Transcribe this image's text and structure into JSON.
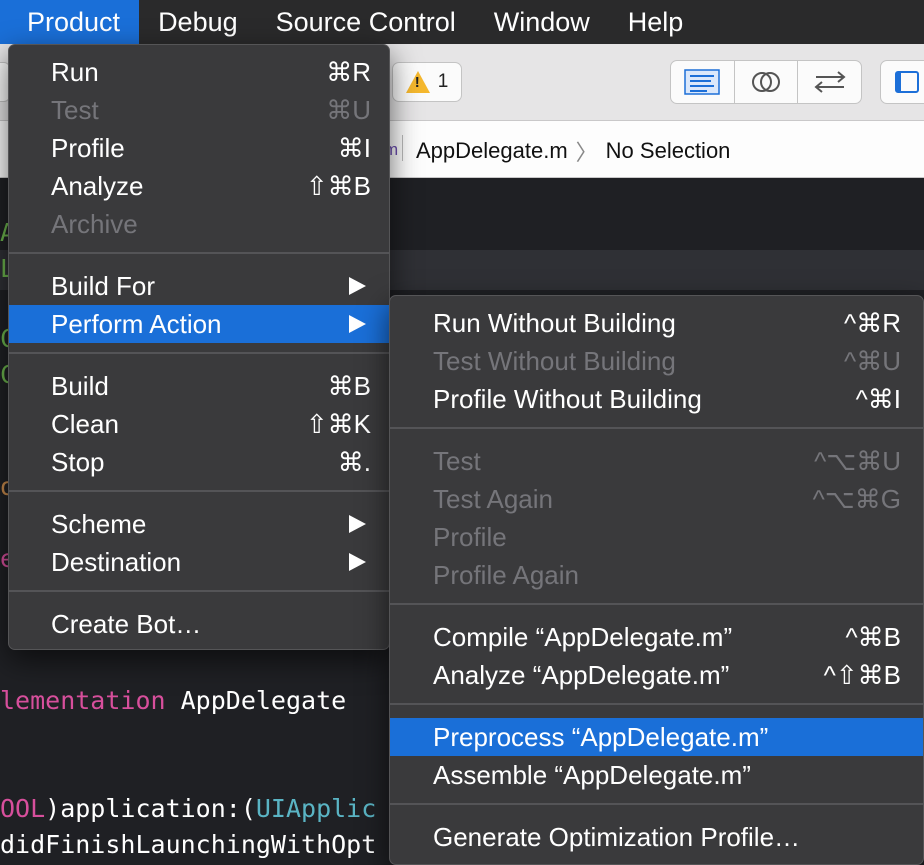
{
  "menubar": {
    "items": [
      "Product",
      "Debug",
      "Source Control",
      "Window",
      "Help"
    ]
  },
  "toolbar": {
    "warning_count": "1"
  },
  "jumpbar": {
    "file": "AppDelegate.m",
    "selection": "No Selection",
    "file_icon_glyph": "m"
  },
  "editor": {
    "lines": {
      "implementation_kw": "lementation",
      "implementation_name": " AppDelegate",
      "app_prefix": "OOL",
      "app_method": ")application:(",
      "app_type": "UIApplic",
      "did_finish": "didFinishLaunchingWithOpt",
      "frag_a": "A",
      "frag_l": "L",
      "frag_c": "C",
      "frag_c2": "C",
      "frag_o": "o",
      "frag_e": "e"
    }
  },
  "product_menu": {
    "items": [
      {
        "label": "Run",
        "shortcut": "⌘R",
        "enabled": true
      },
      {
        "label": "Test",
        "shortcut": "⌘U",
        "enabled": false
      },
      {
        "label": "Profile",
        "shortcut": "⌘I",
        "enabled": true
      },
      {
        "label": "Analyze",
        "shortcut": "⇧⌘B",
        "enabled": true
      },
      {
        "label": "Archive",
        "shortcut": "",
        "enabled": false
      },
      {
        "label": "Build For",
        "submenu": true,
        "enabled": true
      },
      {
        "label": "Perform Action",
        "submenu": true,
        "enabled": true,
        "selected": true
      },
      {
        "label": "Build",
        "shortcut": "⌘B",
        "enabled": true
      },
      {
        "label": "Clean",
        "shortcut": "⇧⌘K",
        "enabled": true
      },
      {
        "label": "Stop",
        "shortcut": "⌘.",
        "enabled": true
      },
      {
        "label": "Scheme",
        "submenu": true,
        "enabled": true
      },
      {
        "label": "Destination",
        "submenu": true,
        "enabled": true
      },
      {
        "label": "Create Bot…",
        "shortcut": "",
        "enabled": true
      }
    ]
  },
  "perform_action_menu": {
    "items": [
      {
        "label": "Run Without Building",
        "shortcut": "^⌘R",
        "enabled": true
      },
      {
        "label": "Test Without Building",
        "shortcut": "^⌘U",
        "enabled": false
      },
      {
        "label": "Profile Without Building",
        "shortcut": "^⌘I",
        "enabled": true
      },
      {
        "label": "Test",
        "shortcut": "^⌥⌘U",
        "enabled": false
      },
      {
        "label": "Test Again",
        "shortcut": "^⌥⌘G",
        "enabled": false
      },
      {
        "label": "Profile",
        "shortcut": "",
        "enabled": false
      },
      {
        "label": "Profile Again",
        "shortcut": "",
        "enabled": false
      },
      {
        "label": "Compile “AppDelegate.m”",
        "shortcut": "^⌘B",
        "enabled": true
      },
      {
        "label": "Analyze “AppDelegate.m”",
        "shortcut": "^⇧⌘B",
        "enabled": true
      },
      {
        "label": "Preprocess “AppDelegate.m”",
        "shortcut": "",
        "enabled": true,
        "selected": true
      },
      {
        "label": "Assemble “AppDelegate.m”",
        "shortcut": "",
        "enabled": true
      },
      {
        "label": "Generate Optimization Profile…",
        "shortcut": "",
        "enabled": true
      }
    ]
  },
  "colors": {
    "accent": "#1a6fd8",
    "menu_bg": "#3a3a3c",
    "disabled_text": "#75757a",
    "warning": "#f5b82e"
  }
}
